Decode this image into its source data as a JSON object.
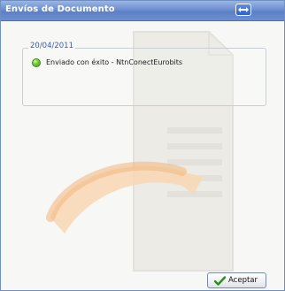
{
  "window": {
    "title": "Envíos de Documento"
  },
  "group": {
    "date": "20/04/2011",
    "items": [
      {
        "status_icon": "green-dot-icon",
        "text": "Enviado con éxito - NtnConectEurobits"
      }
    ]
  },
  "footer": {
    "accept_label": "Aceptar"
  },
  "colors": {
    "titlebar": "#6d8fd0",
    "accent_text": "#3a5fa8",
    "status_ok": "#5cc02a",
    "watermark_orange": "#f5c08a"
  }
}
